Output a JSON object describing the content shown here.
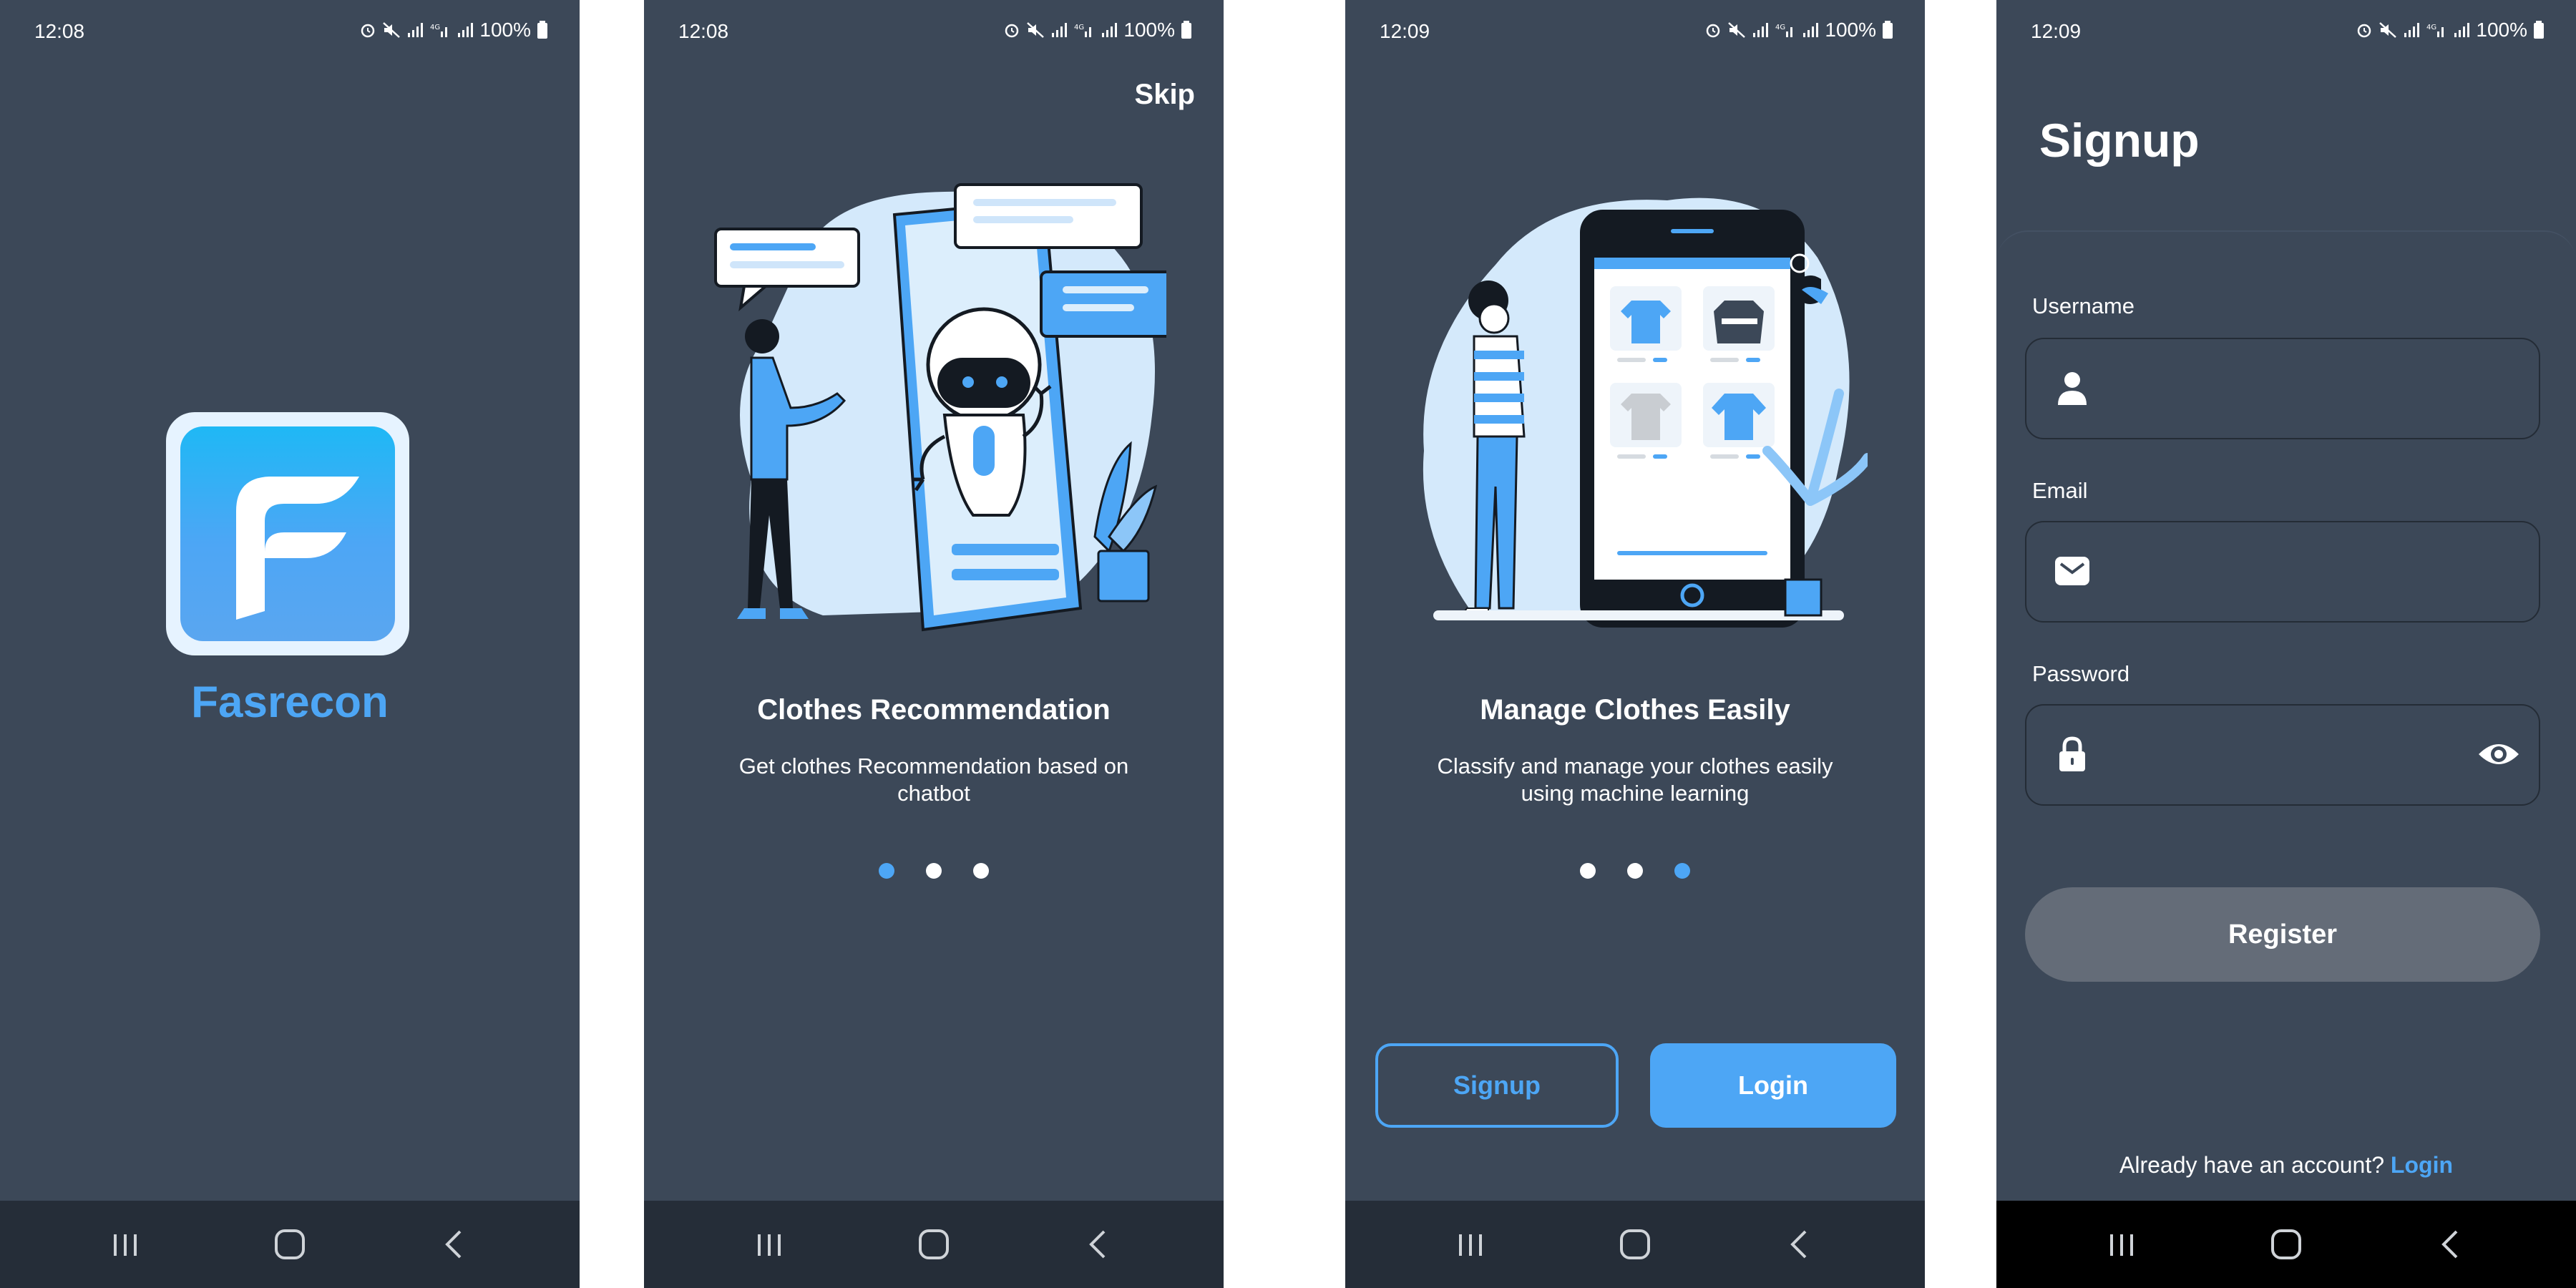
{
  "statusbar_screens": [
    {
      "time": "12:08",
      "battery": "100%"
    },
    {
      "time": "12:08",
      "battery": "100%"
    },
    {
      "time": "12:09",
      "battery": "100%"
    },
    {
      "time": "12:09",
      "battery": "100%"
    }
  ],
  "splash": {
    "app_name": "Fasrecon"
  },
  "onboarding1": {
    "skip_label": "Skip",
    "title": "Clothes Recommendation",
    "description": "Get clothes Recommendation based on chatbot",
    "active_dot": 1
  },
  "onboarding2": {
    "title": "Manage Clothes Easily",
    "description": "Classify and manage your clothes easily using machine learning",
    "active_dot": 3,
    "signup_label": "Signup",
    "login_label": "Login"
  },
  "signup": {
    "title": "Signup",
    "username_label": "Username",
    "email_label": "Email",
    "password_label": "Password",
    "username_value": "",
    "email_value": "",
    "password_value": "",
    "register_label": "Register",
    "have_account_text": "Already have an account?",
    "login_link": "Login"
  },
  "colors": {
    "background": "#3c4858",
    "accent": "#4da6f5",
    "navbar": "#252d38",
    "button_disabled": "#646c78"
  },
  "icons": [
    "alarm-icon",
    "mute-icon",
    "signal-icon",
    "4g-icon",
    "battery-icon",
    "recent-apps-icon",
    "home-icon",
    "back-icon",
    "user-icon",
    "mail-icon",
    "lock-icon",
    "eye-icon"
  ]
}
